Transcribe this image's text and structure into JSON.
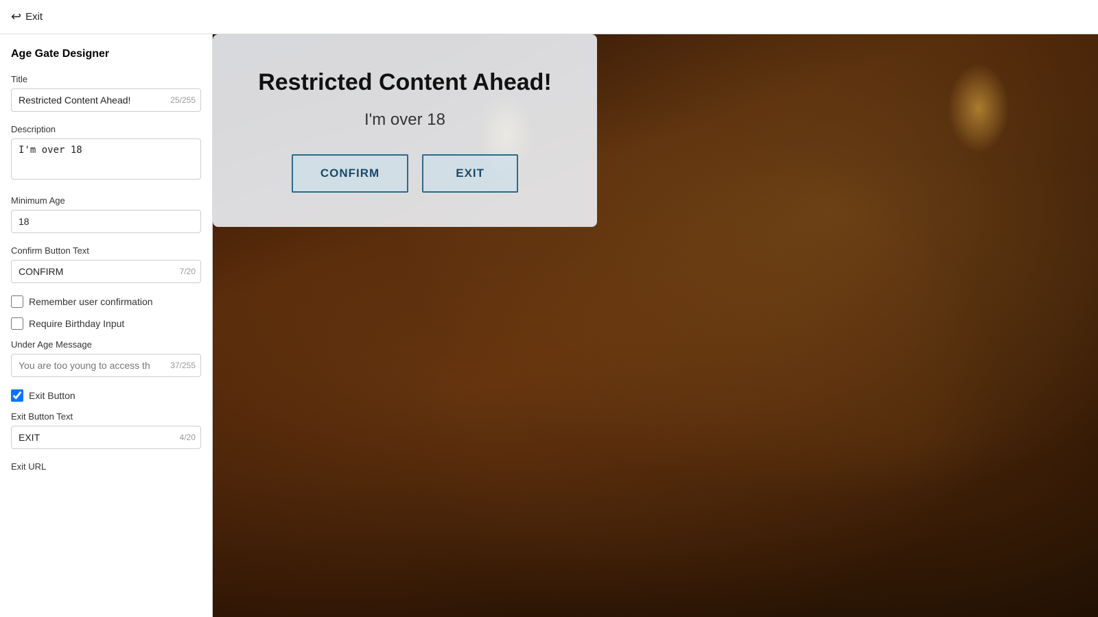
{
  "topBar": {
    "exitLabel": "Exit"
  },
  "sidebar": {
    "heading": "Age Gate Designer",
    "fields": {
      "titleLabel": "Title",
      "titleValue": "Restricted Content Ahead!",
      "titleCharCount": "25/255",
      "descriptionLabel": "Description",
      "descriptionValue": "I'm over 18",
      "minAgeLabel": "Minimum Age",
      "minAgeValue": "18",
      "confirmButtonTextLabel": "Confirm Button Text",
      "confirmButtonTextValue": "CONFIRM",
      "confirmButtonCharCount": "7/20",
      "rememberUserLabel": "Remember user confirmation",
      "requireBirthdayLabel": "Require Birthday Input",
      "underAgeMessageLabel": "Under Age Message",
      "underAgeMessagePlaceholder": "You are too young to access th",
      "underAgeMessageCharCount": "37/255",
      "exitButtonLabel": "Exit Button",
      "exitButtonChecked": true,
      "exitButtonTextLabel": "Exit Button Text",
      "exitButtonTextValue": "EXIT",
      "exitButtonTextCharCount": "4/20",
      "exitUrlLabel": "Exit URL"
    }
  },
  "preview": {
    "modal": {
      "title": "Restricted Content Ahead!",
      "description": "I'm over 18",
      "confirmButtonLabel": "CONFIRM",
      "exitButtonLabel": "EXIT"
    }
  }
}
